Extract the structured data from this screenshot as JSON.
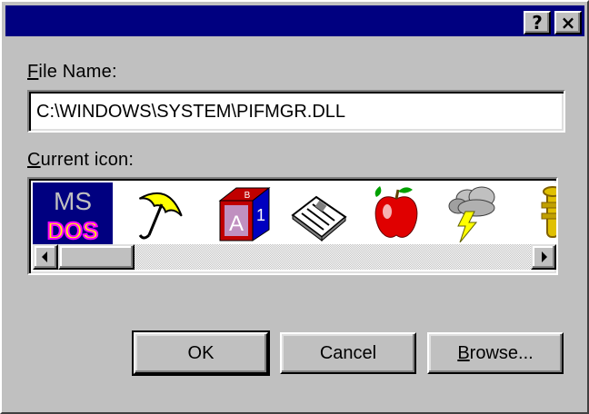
{
  "titlebar": {
    "help_label": "?",
    "close_label": "×",
    "color": "#000080"
  },
  "file_name": {
    "label_accel": "F",
    "label_rest": "ile Name:",
    "value": "C:\\WINDOWS\\SYSTEM\\PIFMGR.DLL"
  },
  "current_icon": {
    "label_accel": "C",
    "label_rest": "urrent icon:",
    "icons": [
      {
        "icon": "ms-dos-icon",
        "selected": true,
        "text_top": "MS",
        "text_bottom": "DOS"
      },
      {
        "icon": "umbrella-icon",
        "selected": false
      },
      {
        "icon": "alphabet-block-icon",
        "selected": false,
        "letters": [
          "B",
          "A",
          "1"
        ]
      },
      {
        "icon": "newspaper-icon",
        "selected": false
      },
      {
        "icon": "apple-icon",
        "selected": false
      },
      {
        "icon": "storm-cloud-icon",
        "selected": false
      },
      {
        "icon": "trumpet-icon",
        "selected": false
      }
    ]
  },
  "buttons": {
    "ok_label": "OK",
    "cancel_label": "Cancel",
    "browse_accel": "B",
    "browse_rest": "rowse..."
  }
}
